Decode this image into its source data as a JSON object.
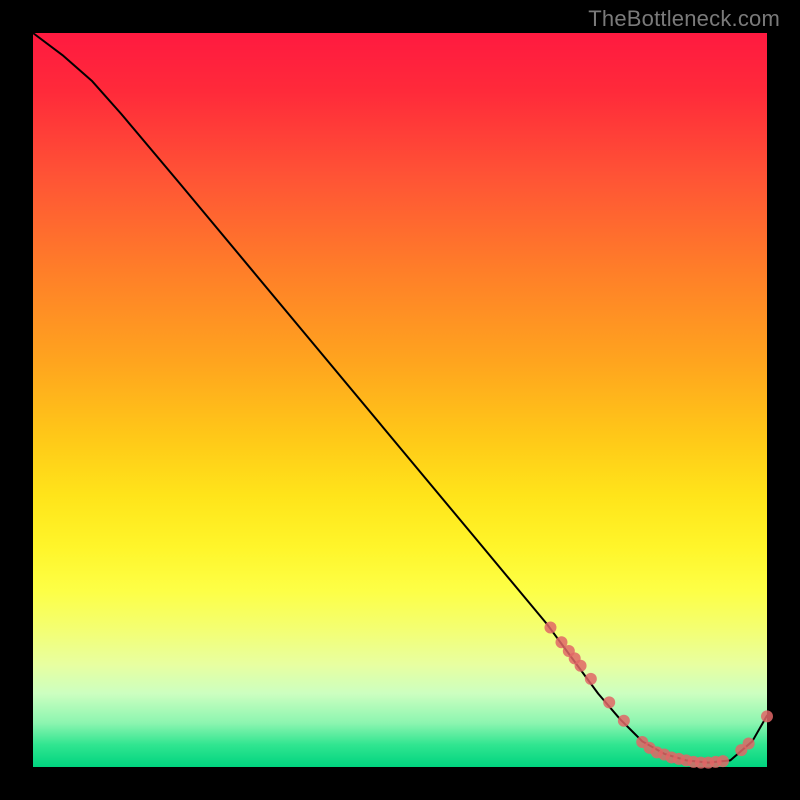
{
  "watermark": "TheBottleneck.com",
  "chart_data": {
    "type": "line",
    "title": "",
    "xlabel": "",
    "ylabel": "",
    "xlim": [
      0,
      100
    ],
    "ylim": [
      0,
      100
    ],
    "grid": false,
    "series": [
      {
        "name": "curve",
        "style": "line",
        "color": "#000000",
        "x": [
          0,
          4,
          8,
          12,
          20,
          30,
          40,
          50,
          60,
          70,
          77,
          80,
          83,
          86,
          89,
          92,
          95,
          98,
          100
        ],
        "y": [
          100,
          97,
          93.5,
          89,
          79.5,
          67.5,
          55.5,
          43.5,
          31.5,
          19.5,
          10,
          6.5,
          3.5,
          1.8,
          0.9,
          0.6,
          0.9,
          3.5,
          7
        ]
      },
      {
        "name": "markers",
        "style": "points",
        "color": "#e06666",
        "x": [
          70.5,
          72.0,
          73.0,
          73.8,
          74.6,
          76.0,
          78.5,
          80.5,
          83.0,
          84.0,
          85.0,
          86.0,
          87.0,
          88.0,
          89.0,
          90.0,
          91.0,
          92.0,
          93.0,
          94.0,
          96.5,
          97.5,
          100.0
        ],
        "y": [
          19.0,
          17.0,
          15.8,
          14.8,
          13.8,
          12.0,
          8.8,
          6.3,
          3.4,
          2.6,
          2.0,
          1.7,
          1.3,
          1.1,
          0.9,
          0.7,
          0.6,
          0.6,
          0.7,
          0.8,
          2.3,
          3.2,
          6.9
        ]
      }
    ]
  }
}
